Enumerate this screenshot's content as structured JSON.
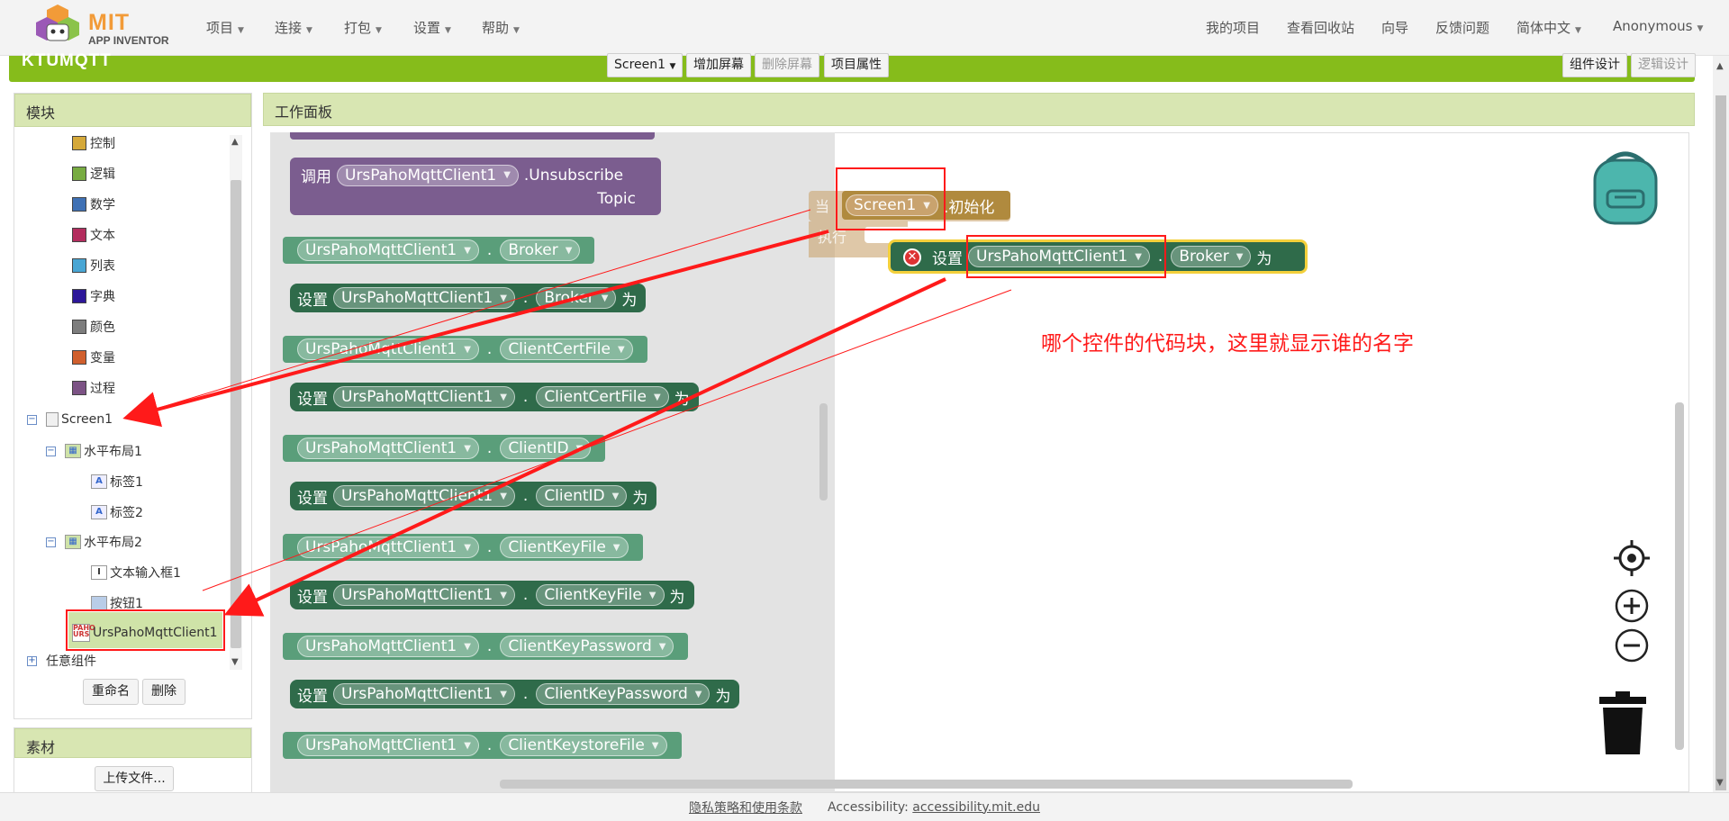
{
  "app": {
    "logo_top": "MIT",
    "logo_bottom": "APP INVENTOR"
  },
  "nav": {
    "left": [
      "项目",
      "连接",
      "打包",
      "设置",
      "帮助"
    ],
    "right": {
      "my_projects": "我的项目",
      "trash": "查看回收站",
      "guide": "向导",
      "feedback": "反馈问题",
      "language": "简体中文",
      "user": "Anonymous"
    }
  },
  "toolbar": {
    "project_name": "KTUMQTT",
    "screen_select": "Screen1",
    "add_screen": "增加屏幕",
    "remove_screen": "删除屏幕",
    "project_props": "项目属性",
    "designer": "组件设计",
    "blocks": "逻辑设计"
  },
  "blocks_panel": {
    "title": "模块",
    "builtin": [
      {
        "label": "控制",
        "color": "#d5a93a"
      },
      {
        "label": "逻辑",
        "color": "#77ab41"
      },
      {
        "label": "数学",
        "color": "#3f71b5"
      },
      {
        "label": "文本",
        "color": "#b32d5e"
      },
      {
        "label": "列表",
        "color": "#49a6d4"
      },
      {
        "label": "字典",
        "color": "#2d1799"
      },
      {
        "label": "颜色",
        "color": "#7d7d7d"
      },
      {
        "label": "变量",
        "color": "#d05f2d"
      },
      {
        "label": "过程",
        "color": "#7c5385"
      }
    ],
    "screen": "Screen1",
    "hlayout1": "水平布局1",
    "label1": "标签1",
    "label2": "标签2",
    "hlayout2": "水平布局2",
    "textbox1": "文本输入框1",
    "button1": "按钮1",
    "mqtt": "UrsPahoMqttClient1",
    "any": "任意组件",
    "rename": "重命名",
    "delete": "删除"
  },
  "assets": {
    "title": "素材",
    "upload": "上传文件..."
  },
  "workspace": {
    "title": "工作面板",
    "call_kw": "调用",
    "component": "UrsPahoMqttClient1",
    "unsubscribe": ".Unsubscribe",
    "topic": "Topic",
    "set_kw": "设置",
    "to_kw": "为",
    "props": [
      "Broker",
      "ClientCertFile",
      "ClientID",
      "ClientKeyFile",
      "ClientKeyPassword",
      "ClientKeystoreFile"
    ],
    "partial_prop": "ClientKeystoreFile",
    "event_when": "当",
    "event_do": "执行",
    "event_screen": "Screen1",
    "event_init": ".初始化",
    "annotation": "哪个控件的代码块，这里就显示谁的名字"
  },
  "footer": {
    "privacy": "隐私策略和使用条款",
    "access_label": "Accessibility:",
    "access_link": "accessibility.mit.edu"
  }
}
